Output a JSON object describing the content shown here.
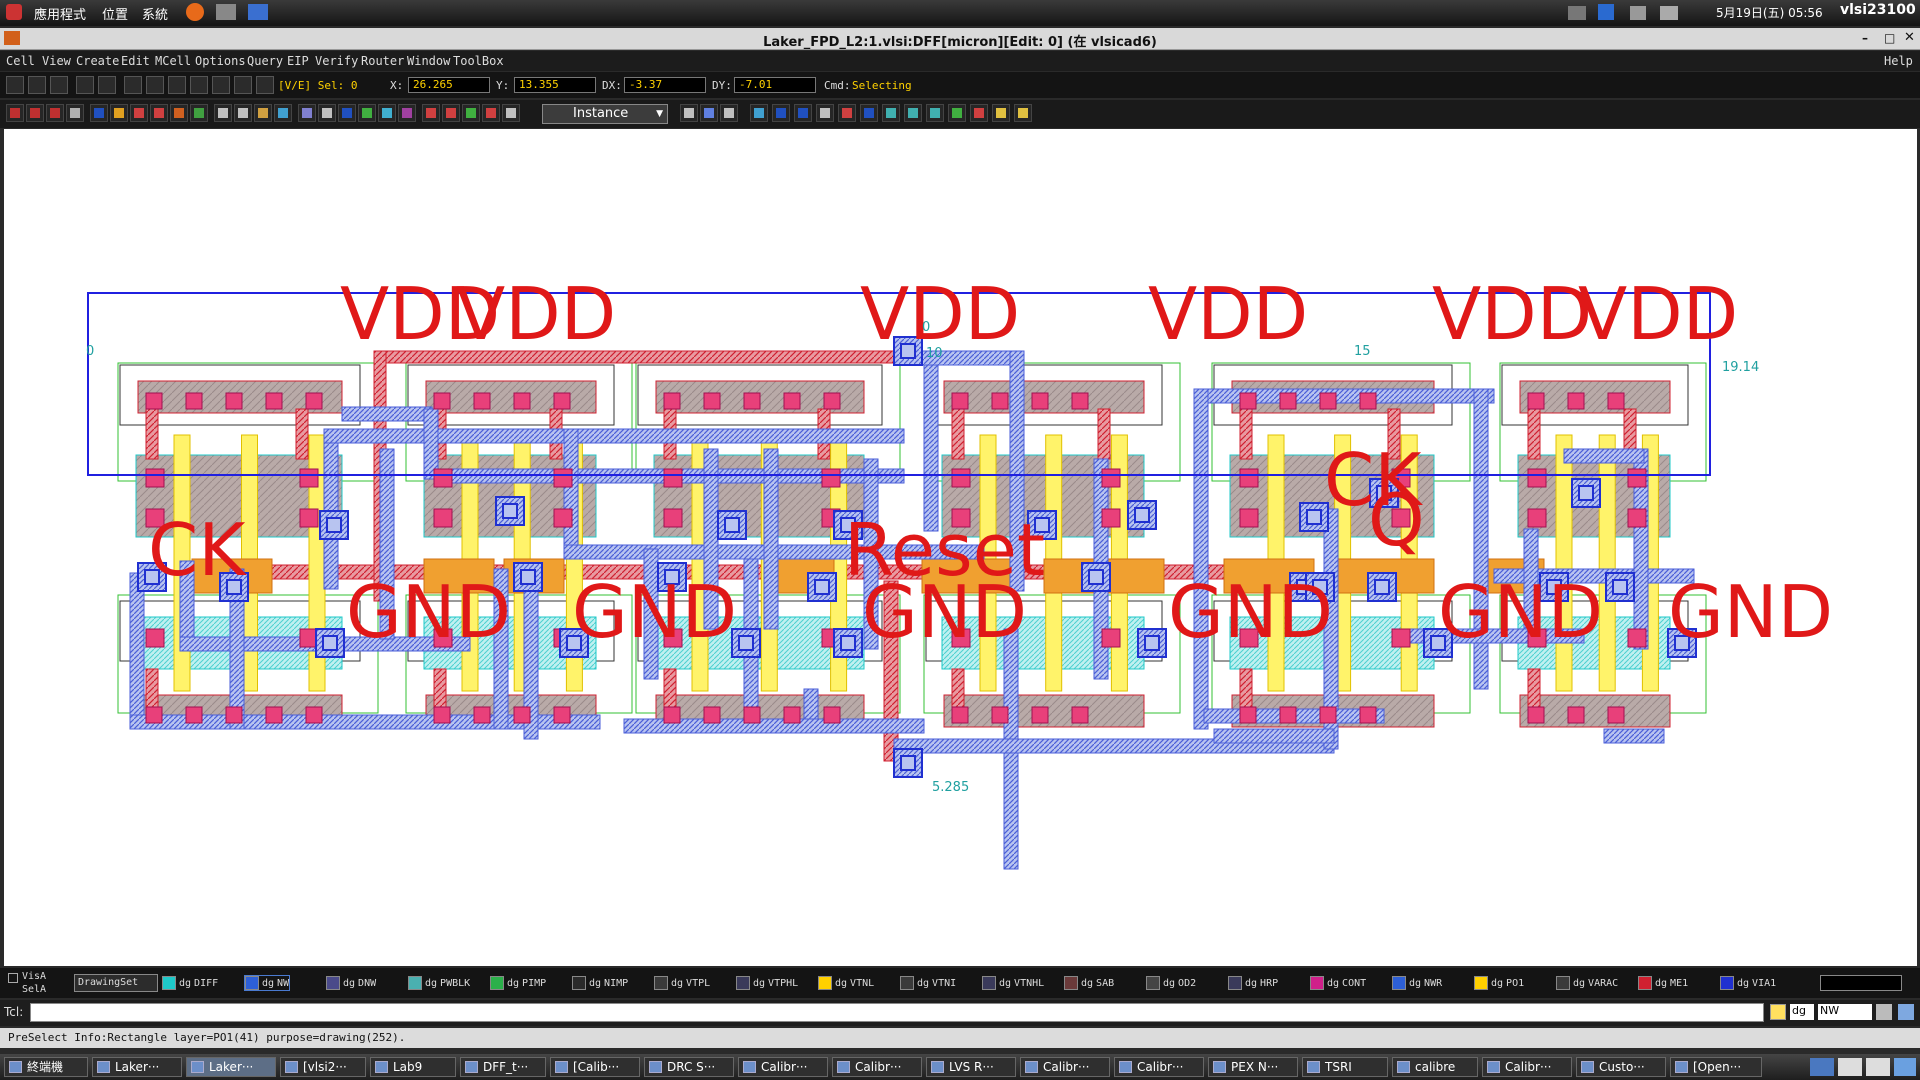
{
  "topbar": {
    "apps": "應用程式",
    "places": "位置",
    "system": "系統",
    "datetime": "5月19日(五) 05:56",
    "user": "vlsi23100"
  },
  "window": {
    "title": "Laker_FPD_L2:1.vlsi:DFF[micron][Edit: 0] (在 vlsicad6)"
  },
  "menu": [
    "Cell",
    "View",
    "Create",
    "Edit",
    "MCell",
    "Options",
    "Query",
    "EIP",
    "Verify",
    "Router",
    "Window",
    "ToolBox"
  ],
  "menu_help": "Help",
  "coords": {
    "mode": "[V/E] Sel: 0",
    "x_label": "X:",
    "x": "26.265",
    "y_label": "Y:",
    "y": "13.355",
    "dx_label": "DX:",
    "dx": "-3.37",
    "dy_label": "DY:",
    "dy": "-7.01",
    "cmd_label": "Cmd:",
    "cmd": "Selecting"
  },
  "instance_select": "Instance",
  "canvas": {
    "ruler": [
      "0",
      "0",
      "10",
      "15",
      "19.14",
      "5.285"
    ],
    "net_labels": [
      "VDD",
      "VDD",
      "VDD",
      "VDD",
      "VDD",
      "VDD",
      "GND",
      "GND",
      "GND",
      "GND",
      "GND",
      "GND",
      "CK",
      "Reset",
      "Q",
      "CK"
    ]
  },
  "layers": {
    "visa": "VisA",
    "sela": "SelA",
    "set": "DrawingSet",
    "items": [
      {
        "purpose": "dg",
        "name": "DIFF",
        "color": "#1ec8c8"
      },
      {
        "purpose": "dg",
        "name": "NW",
        "color": "#2d5fd6"
      },
      {
        "purpose": "dg",
        "name": "DNW",
        "color": "#4a4a8a"
      },
      {
        "purpose": "dg",
        "name": "PWBLK",
        "color": "#4ab0b0"
      },
      {
        "purpose": "dg",
        "name": "PIMP",
        "color": "#2bb04a"
      },
      {
        "purpose": "dg",
        "name": "NIMP",
        "color": "#2a2a2a"
      },
      {
        "purpose": "dg",
        "name": "VTPL",
        "color": "#3a3a3a"
      },
      {
        "purpose": "dg",
        "name": "VTPHL",
        "color": "#3a3a5a"
      },
      {
        "purpose": "dg",
        "name": "VTNL",
        "color": "#ffd000"
      },
      {
        "purpose": "dg",
        "name": "VTNI",
        "color": "#3a3a3a"
      },
      {
        "purpose": "dg",
        "name": "VTNHL",
        "color": "#3a3a5a"
      },
      {
        "purpose": "dg",
        "name": "SAB",
        "color": "#6a3a3a"
      },
      {
        "purpose": "dg",
        "name": "OD2",
        "color": "#444444"
      },
      {
        "purpose": "dg",
        "name": "HRP",
        "color": "#3a3a5a"
      },
      {
        "purpose": "dg",
        "name": "CONT",
        "color": "#d0208a"
      },
      {
        "purpose": "dg",
        "name": "NWR",
        "color": "#2d5fd6"
      },
      {
        "purpose": "dg",
        "name": "PO1",
        "color": "#ffd000"
      },
      {
        "purpose": "dg",
        "name": "VARAC",
        "color": "#3a3a3a"
      },
      {
        "purpose": "dg",
        "name": "ME1",
        "color": "#d02030"
      },
      {
        "purpose": "dg",
        "name": "VIA1",
        "color": "#2030d0"
      }
    ]
  },
  "tcl": {
    "label": "Tcl:",
    "current_purpose": "dg",
    "current_layer": "NW"
  },
  "status": "PreSelect Info:Rectangle  layer=PO1(41) purpose=drawing(252).",
  "taskbar": [
    "終端機",
    "Laker···",
    "Laker···",
    "[vlsi2···",
    "Lab9",
    "DFF_t···",
    "[Calib···",
    "DRC S···",
    "Calibr···",
    "Calibr···",
    "LVS R···",
    "Calibr···",
    "Calibr···",
    "PEX N···",
    "TSRI",
    "calibre",
    "Calibr···",
    "Custo···",
    "[Open···"
  ]
}
